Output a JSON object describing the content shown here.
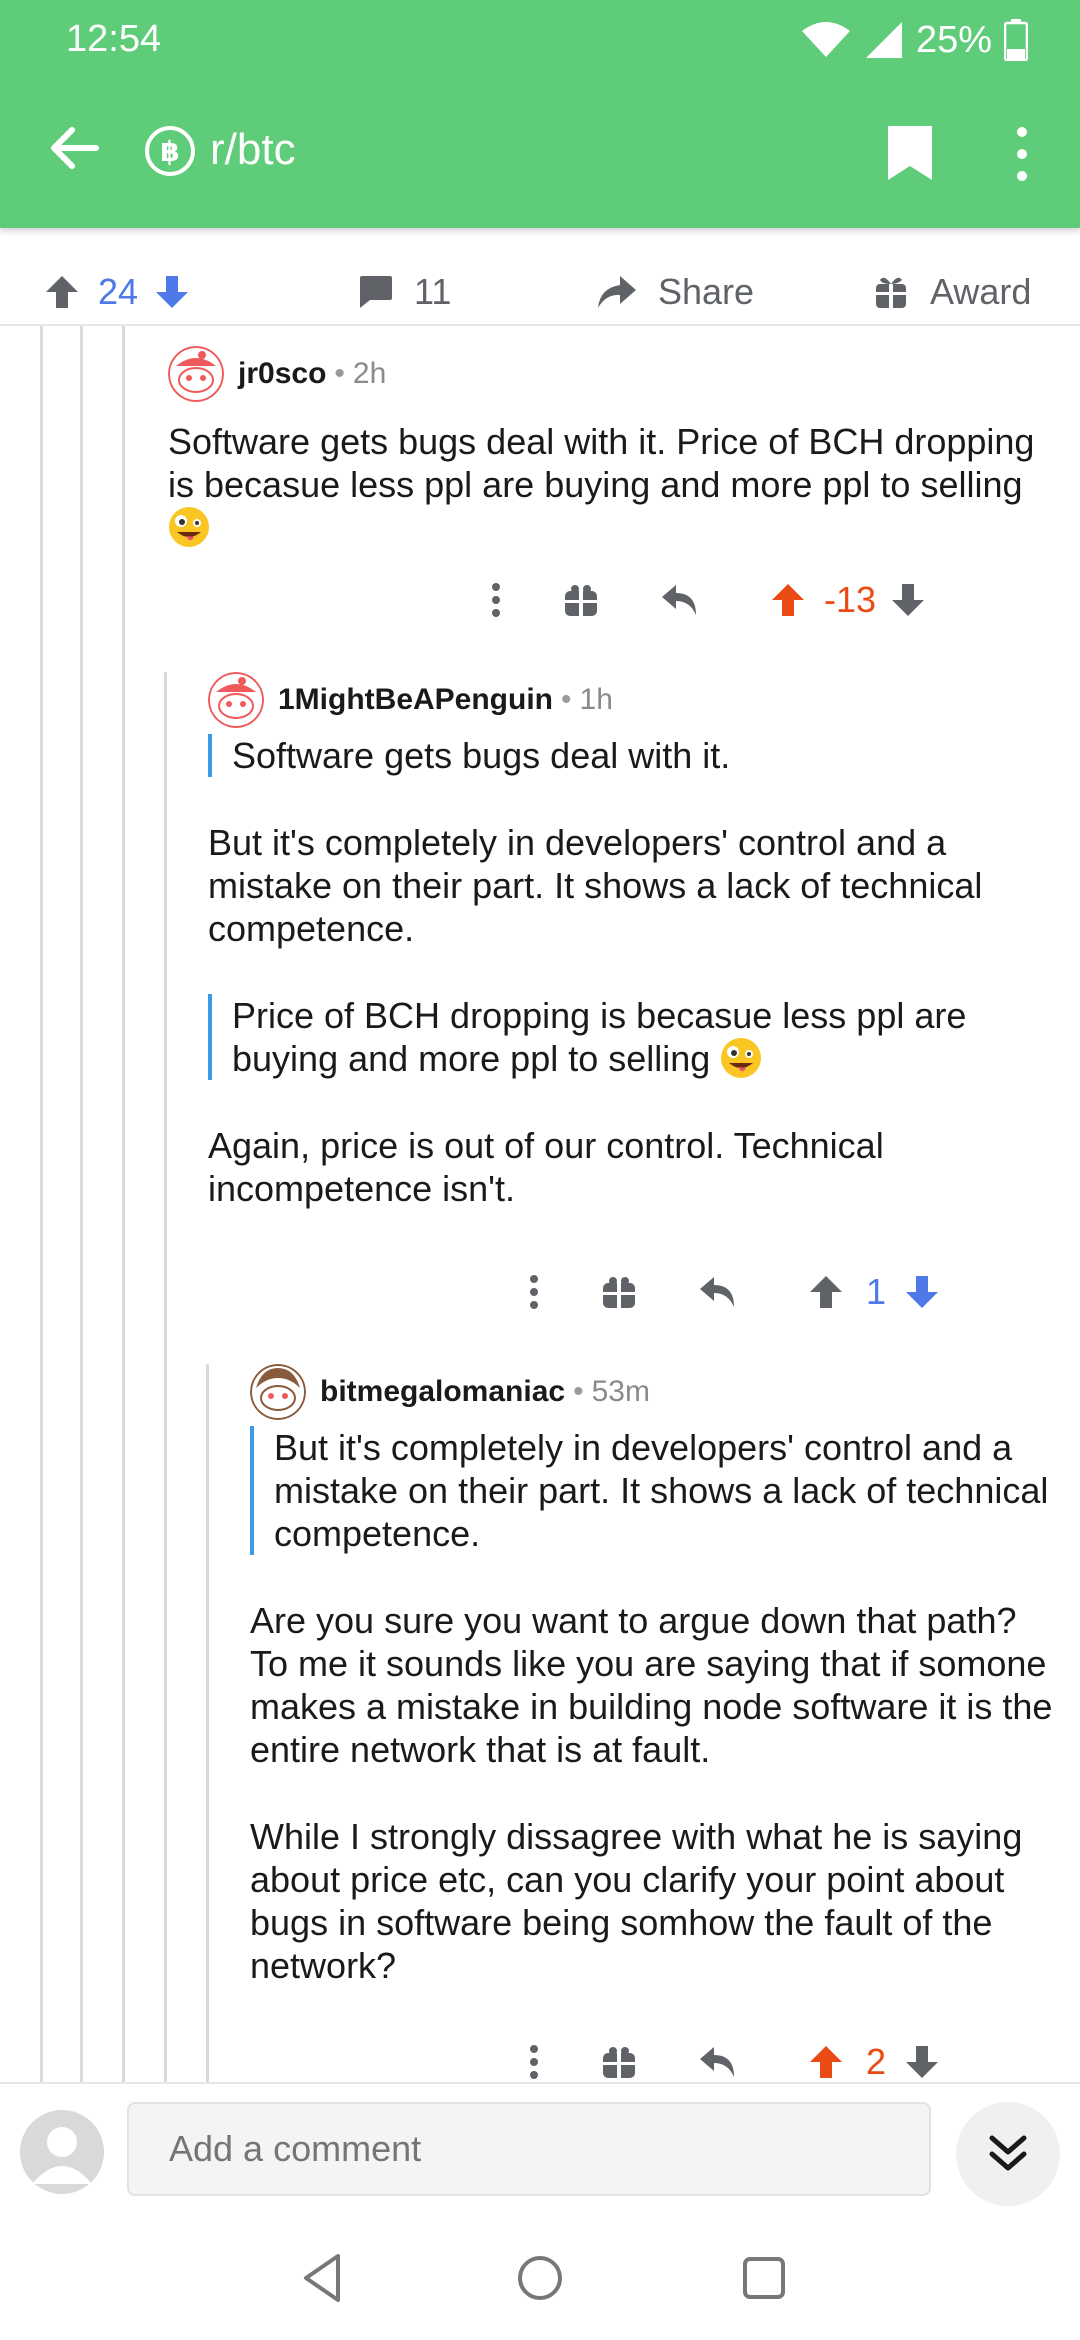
{
  "status": {
    "time": "12:54",
    "battery": "25%"
  },
  "header": {
    "subreddit": "r/btc",
    "sub_badge_glyph": "฿"
  },
  "post_actions": {
    "score": "24",
    "comments": "11",
    "share_label": "Share",
    "award_label": "Award"
  },
  "comments": [
    {
      "user": "jr0sco",
      "age": "2h",
      "body": "Software gets bugs deal with it. Price of BCH dropping is becasue less ppl are buying and more ppl to selling",
      "score": "-13",
      "vote": "up"
    },
    {
      "user": "1MightBeAPenguin",
      "age": "1h",
      "quote1": "Software gets bugs deal with it.",
      "para1": "But it's completely in developers' control and a mistake on their part. It shows a lack of technical competence.",
      "quote2": "Price of BCH dropping is becasue less ppl are buying and more ppl to selling",
      "para2": "Again, price is out of our control. Technical incompetence isn't.",
      "score": "1",
      "vote": "down"
    },
    {
      "user": "bitmegalomaniac",
      "age": "53m",
      "quote1": "But it's completely in developers' control and a mistake on their part. It shows a lack of technical competence.",
      "para1": "Are you sure you want to argue down that path?  To me it sounds like you are saying that if somone makes a mistake in building node software it is the entire network that is at fault.",
      "para2": "While I strongly dissagree with what he is saying about price etc, can you clarify your point about bugs in software being somhow the fault of the network?",
      "score": "2",
      "vote": "up"
    }
  ],
  "composer": {
    "placeholder": "Add a comment"
  },
  "colors": {
    "header_green": "#5fcc7a",
    "upvote_orange": "#ea4b14",
    "downvote_blue": "#4f78e8",
    "quote_bar": "#3c9be8"
  }
}
